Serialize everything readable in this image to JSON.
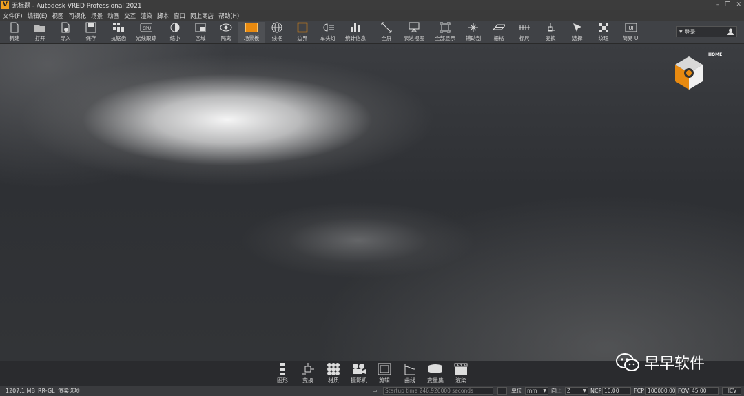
{
  "window": {
    "title": "无标题 - Autodesk VRED Professional 2021",
    "logo_letter": "V",
    "controls": [
      "–",
      "❐",
      "✕"
    ]
  },
  "menu": [
    "文件(F)",
    "编辑(E)",
    "视图",
    "可视化",
    "场景",
    "动画",
    "交互",
    "渲染",
    "脚本",
    "窗口",
    "网上商店",
    "帮助(H)"
  ],
  "toolbar": {
    "tools": [
      {
        "label": "新建",
        "icon": "new-file-icon"
      },
      {
        "label": "打开",
        "icon": "folder-open-icon"
      },
      {
        "label": "导入",
        "icon": "import-icon"
      },
      {
        "label": "保存",
        "icon": "save-icon"
      },
      {
        "label": "抗锯齿",
        "icon": "antialias-icon"
      },
      {
        "label": "光线跟踪",
        "icon": "cpu-raytracing-icon"
      },
      {
        "label": "缩小",
        "icon": "contrast-icon"
      },
      {
        "label": "区域",
        "icon": "region-icon"
      },
      {
        "label": "隔离",
        "icon": "eye-icon"
      },
      {
        "label": "场景板",
        "icon": "scene-plate-icon"
      },
      {
        "label": "线框",
        "icon": "wireframe-globe-icon"
      },
      {
        "label": "边界",
        "icon": "bounding-box-icon"
      },
      {
        "label": "车头灯",
        "icon": "headlight-icon"
      },
      {
        "label": "统计信息",
        "icon": "statistics-icon"
      },
      {
        "label": "全屏",
        "icon": "fullscreen-icon"
      },
      {
        "label": "表达视图",
        "icon": "presentation-icon"
      },
      {
        "label": "全部显示",
        "icon": "show-all-icon"
      },
      {
        "label": "辅助剖",
        "icon": "clipping-icon"
      },
      {
        "label": "栅格",
        "icon": "grid-icon"
      },
      {
        "label": "标尺",
        "icon": "ruler-icon"
      },
      {
        "label": "变换",
        "icon": "transform-icon"
      },
      {
        "label": "选择",
        "icon": "select-icon"
      },
      {
        "label": "纹理",
        "icon": "texture-icon"
      },
      {
        "label": "简易 UI",
        "icon": "simple-ui-icon"
      }
    ],
    "login_label": "登录",
    "ui_badge": "UI",
    "cpu_badge": "CPU"
  },
  "viewport": {
    "navcube_home_label": "HOME"
  },
  "modules": [
    {
      "label": "图形",
      "icon": "graph-icon"
    },
    {
      "label": "变换",
      "icon": "transform-module-icon"
    },
    {
      "label": "材质",
      "icon": "materials-icon"
    },
    {
      "label": "摄影机",
      "icon": "camera-icon"
    },
    {
      "label": "剪辑",
      "icon": "clip-icon"
    },
    {
      "label": "曲线",
      "icon": "curves-icon"
    },
    {
      "label": "变量集",
      "icon": "variant-sets-icon"
    },
    {
      "label": "渲染",
      "icon": "render-icon"
    }
  ],
  "watermark": "早早软件",
  "status": {
    "memory": "1207.1 MB",
    "renderer": "RR-GL",
    "render_mode": "渲染选项",
    "message": "Startup time 246.926000 seconds",
    "unit_label": "单位",
    "unit_value": "mm",
    "up_label": "向上",
    "up_value": "Z",
    "ncp_label": "NCP",
    "ncp_value": "10.00",
    "fcp_label": "FCP",
    "fcp_value": "100000.00",
    "fov_label": "FOV",
    "fov_value": "45.00",
    "icv_label": "ICV"
  },
  "colors": {
    "accent": "#e88a10",
    "background": "#2b2d30"
  }
}
